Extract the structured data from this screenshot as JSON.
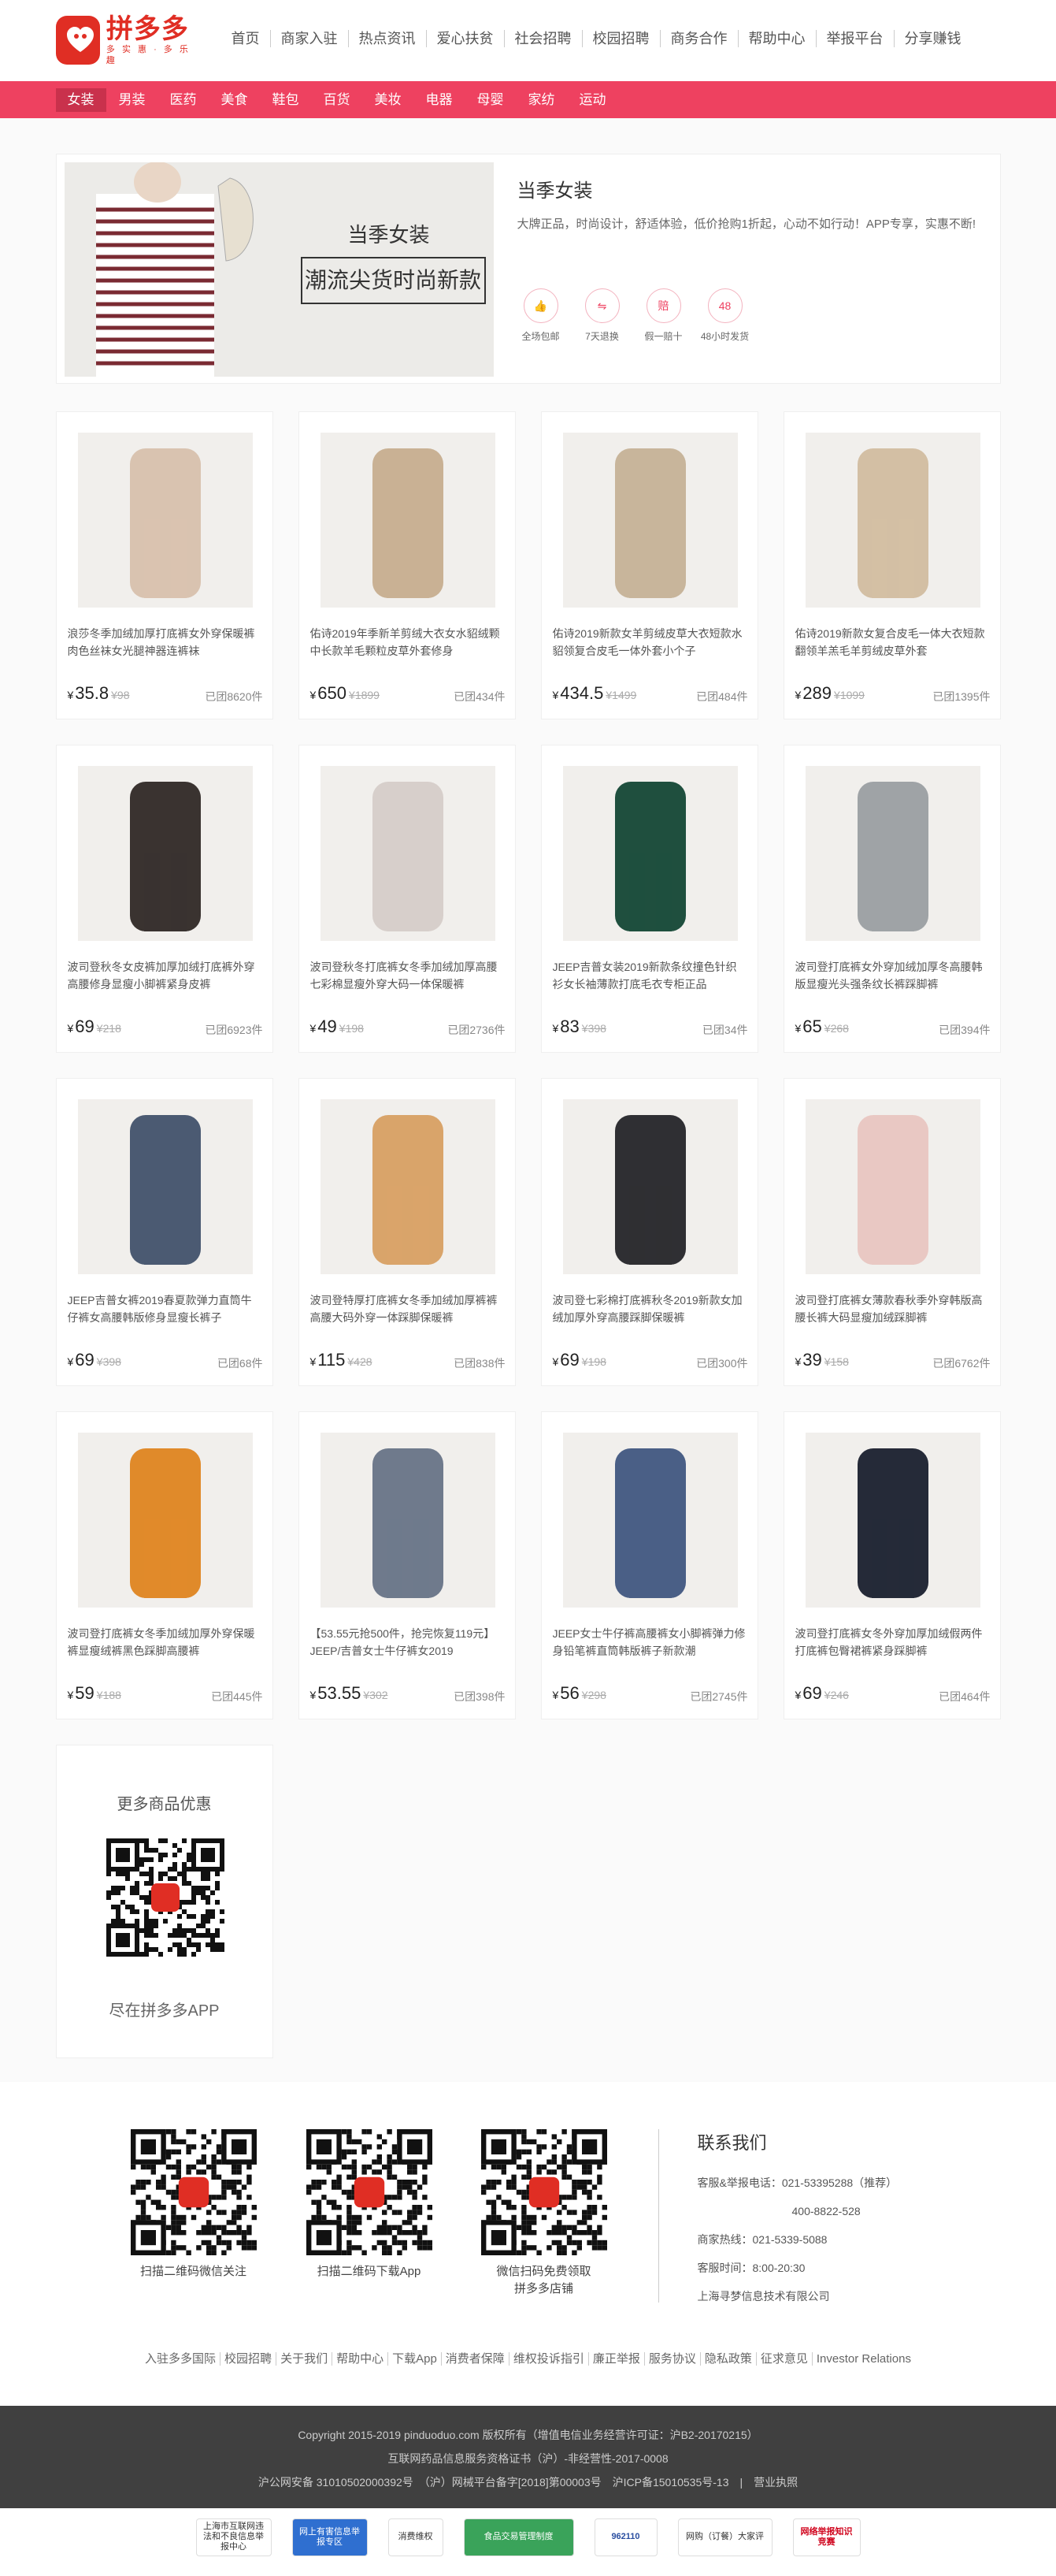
{
  "header": {
    "logo_name": "拼多多",
    "logo_slogan": "多 实 惠 · 多 乐 趣",
    "nav": [
      "首页",
      "商家入驻",
      "热点资讯",
      "爱心扶贫",
      "社会招聘",
      "校园招聘",
      "商务合作",
      "帮助中心",
      "举报平台",
      "分享赚钱"
    ]
  },
  "categories": [
    "女装",
    "男装",
    "医药",
    "美食",
    "鞋包",
    "百货",
    "美妆",
    "电器",
    "母婴",
    "家纺",
    "运动"
  ],
  "banner": {
    "caption1": "当季女装",
    "caption2": "潮流尖货时尚新款",
    "title": "当季女装",
    "description": "大牌正品，时尚设计，舒适体验，低价抢购1折起，心动不如行动！APP专享，实惠不断!",
    "features": [
      {
        "icon": "thumb-up",
        "glyph": "👍",
        "label": "全场包邮"
      },
      {
        "icon": "return",
        "glyph": "⇋",
        "label": "7天退换"
      },
      {
        "icon": "compensate",
        "glyph": "赔",
        "label": "假一赔十"
      },
      {
        "icon": "48h",
        "glyph": "48",
        "label": "48小时发货"
      }
    ]
  },
  "products": [
    {
      "name": "浪莎冬季加绒加厚打底裤女外穿保暖裤肉色丝袜女光腿神器连裤袜",
      "price": "35.8",
      "orig": "98",
      "sold": "已团8620件",
      "color": "#d9c3b0"
    },
    {
      "name": "佑诗2019年季新羊剪绒大衣女水貂绒颗中长款羊毛颗粒皮草外套修身",
      "price": "650",
      "orig": "1899",
      "sold": "已团434件",
      "color": "#c9b194"
    },
    {
      "name": "佑诗2019新款女羊剪绒皮草大衣短款水貂领复合皮毛一体外套小个子",
      "price": "434.5",
      "orig": "1499",
      "sold": "已团484件",
      "color": "#c8b59b"
    },
    {
      "name": "佑诗2019新款女复合皮毛一体大衣短款翻领羊羔毛羊剪绒皮草外套",
      "price": "289",
      "orig": "1099",
      "sold": "已团1395件",
      "color": "#d3bfa4"
    },
    {
      "name": "波司登秋冬女皮裤加厚加绒打底裤外穿高腰修身显瘦小脚裤紧身皮裤",
      "price": "69",
      "orig": "218",
      "sold": "已团6923件",
      "color": "#3a3330"
    },
    {
      "name": "波司登秋冬打底裤女冬季加绒加厚高腰七彩棉显瘦外穿大码一体保暖裤",
      "price": "49",
      "orig": "198",
      "sold": "已团2736件",
      "color": "#d7cfcb"
    },
    {
      "name": "JEEP吉普女装2019新款条纹撞色针织衫女长袖薄款打底毛衣专柜正品",
      "price": "83",
      "orig": "398",
      "sold": "已团34件",
      "color": "#1f4f3e"
    },
    {
      "name": "波司登打底裤女外穿加绒加厚冬高腰韩版显瘦光头强条纹长裤踩脚裤",
      "price": "65",
      "orig": "268",
      "sold": "已团394件",
      "color": "#9fa3a6"
    },
    {
      "name": "JEEP吉普女裤2019春夏款弹力直筒牛仔裤女高腰韩版修身显瘦长裤子",
      "price": "69",
      "orig": "398",
      "sold": "已团68件",
      "color": "#4b5a72"
    },
    {
      "name": "波司登特厚打底裤女冬季加绒加厚裤裤高腰大码外穿一体踩脚保暖裤",
      "price": "115",
      "orig": "428",
      "sold": "已团838件",
      "color": "#d9a46a"
    },
    {
      "name": "波司登七彩棉打底裤秋冬2019新款女加绒加厚外穿高腰踩脚保暖裤",
      "price": "69",
      "orig": "198",
      "sold": "已团300件",
      "color": "#2f2f33"
    },
    {
      "name": "波司登打底裤女薄款春秋季外穿韩版高腰长裤大码显瘦加绒踩脚裤",
      "price": "39",
      "orig": "158",
      "sold": "已团6762件",
      "color": "#e9c8c3"
    },
    {
      "name": "波司登打底裤女冬季加绒加厚外穿保暖裤显瘦绒裤黑色踩脚高腰裤",
      "price": "59",
      "orig": "188",
      "sold": "已团445件",
      "color": "#e08a2a"
    },
    {
      "name": "【53.55元抢500件，抢完恢复119元】JEEP/吉普女士牛仔裤女2019",
      "price": "53.55",
      "orig": "302",
      "sold": "已团398件",
      "color": "#6f7a8c"
    },
    {
      "name": "JEEP女士牛仔裤高腰裤女小脚裤弹力修身铅笔裤直筒韩版裤子新款潮",
      "price": "56",
      "orig": "298",
      "sold": "已团2745件",
      "color": "#4a5f86"
    },
    {
      "name": "波司登打底裤女冬外穿加厚加绒假两件打底裤包臀裙裤紧身踩脚裤",
      "price": "69",
      "orig": "246",
      "sold": "已团464件",
      "color": "#252a38"
    }
  ],
  "more": {
    "title": "更多商品优惠",
    "app": "尽在拼多多APP"
  },
  "footer": {
    "qrs": [
      "扫描二维码微信关注",
      "扫描二维码下载App",
      "微信扫码免费领取\n拼多多店铺"
    ],
    "contact_title": "联系我们",
    "contact_lines": [
      "客服&举报电话：021-53395288（推荐）",
      "400-8822-528",
      "商家热线：021-5339-5088",
      "客服时间：8:00-20:30",
      "上海寻梦信息技术有限公司"
    ],
    "links": [
      "入驻多多国际",
      "校园招聘",
      "关于我们",
      "帮助中心",
      "下载App",
      "消费者保障",
      "维权投诉指引",
      "廉正举报",
      "服务协议",
      "隐私政策",
      "征求意见",
      "Investor Relations"
    ],
    "copyright": [
      "Copyright 2015-2019 pinduoduo.com 版权所有（增值电信业务经营许可证：沪B2-20170215）",
      "互联网药品信息服务资格证书（沪）-非经营性-2017-0008",
      "沪公网安备 31010502000392号　（沪）网械平台备字[2018]第00003号　沪ICP备15010535号-13　|　营业执照"
    ],
    "badges": [
      "上海市互联网违法和不良信息举报中心",
      "网上有害信息举报专区",
      "消费维权",
      "食品交易管理制度",
      "962110",
      "网购（订餐）大家评",
      "网络举报知识竞赛"
    ]
  }
}
